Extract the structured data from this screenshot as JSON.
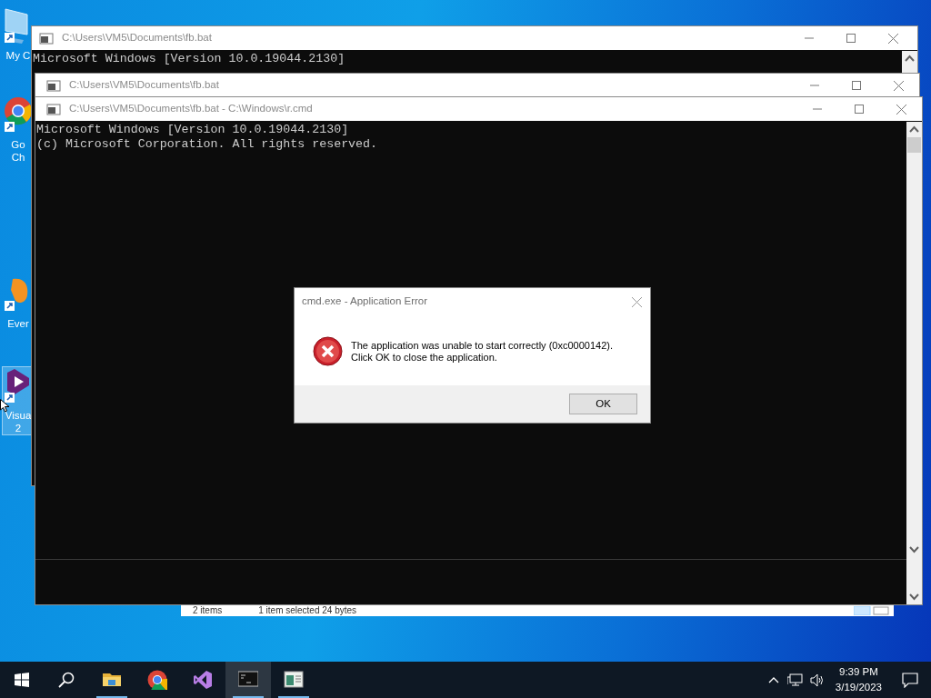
{
  "desktop_icons": [
    {
      "kind": "computer",
      "lines": [
        "My C"
      ],
      "selected": false
    },
    {
      "kind": "chrome",
      "lines": [
        "Go",
        "Ch"
      ],
      "selected": false
    },
    {
      "kind": "evernote",
      "lines": [
        "Ever"
      ],
      "selected": false
    },
    {
      "kind": "studio",
      "lines": [
        "Visua",
        "2"
      ],
      "selected": true
    }
  ],
  "explorer_status": {
    "items": "2 items",
    "selection": "1 item selected  24 bytes"
  },
  "windows": [
    {
      "title": "C:\\Users\\VM5\\Documents\\fb.bat",
      "lines": [
        "Microsoft Windows [Version 10.0.19044.2130]"
      ]
    },
    {
      "title": "C:\\Users\\VM5\\Documents\\fb.bat"
    },
    {
      "title": "C:\\Users\\VM5\\Documents\\fb.bat - C:\\Windows\\r.cmd",
      "lines": [
        "Microsoft Windows [Version 10.0.19044.2130]",
        "(c) Microsoft Corporation. All rights reserved."
      ]
    }
  ],
  "dialog": {
    "title": "cmd.exe - Application Error",
    "message": [
      "The application was unable to start correctly (0xc0000142).",
      "Click OK to close the application."
    ],
    "button": "OK"
  },
  "taskbar": {
    "apps": [
      {
        "kind": "explorer",
        "running": true,
        "active": false
      },
      {
        "kind": "chrome",
        "running": false,
        "active": false
      },
      {
        "kind": "studio",
        "running": false,
        "active": false
      },
      {
        "kind": "console",
        "running": true,
        "active": true
      },
      {
        "kind": "window",
        "running": true,
        "active": false
      }
    ],
    "time": "9:39 PM",
    "date": "3/19/2023"
  }
}
